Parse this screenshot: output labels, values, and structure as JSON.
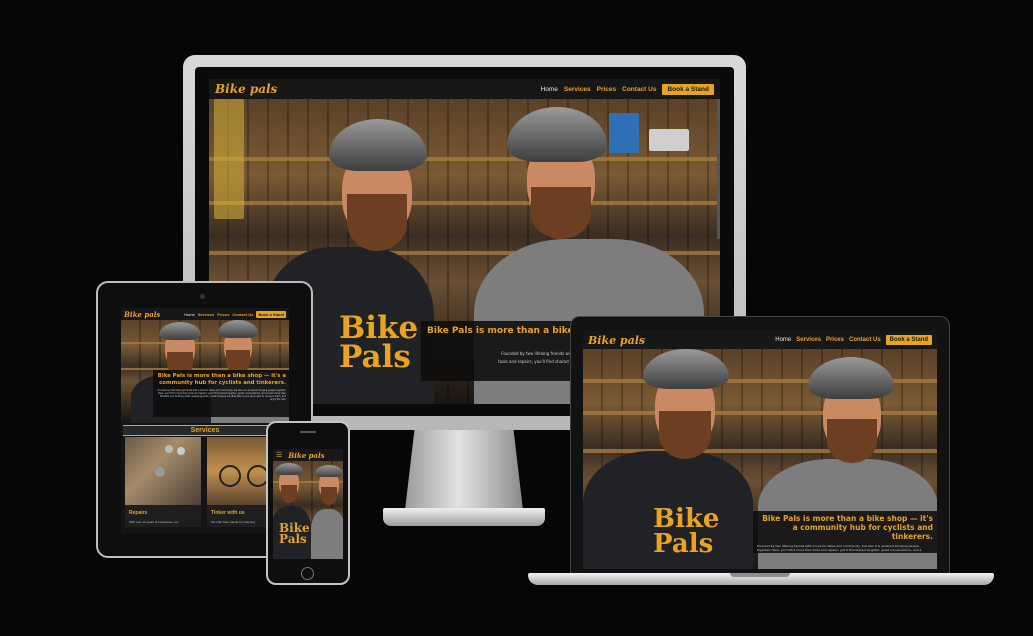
{
  "site": {
    "logo": "Bike pals",
    "nav": {
      "home": "Home",
      "services": "Services",
      "prices": "Prices",
      "contact": "Contact Us",
      "cta": "Book a Stand"
    },
    "shirt_text_line1": "Bike",
    "shirt_text_line2": "Pals",
    "hero_heading_desktop": "Bike Pals is more than a bike",
    "hero_heading_full": "Bike Pals is more than a bike shop — it's a community hub for cyclists and tinkerers.",
    "hero_body_desktop_1": "Founded by two lifelong friends with a love for bikes and community,",
    "hero_body_desktop_2": "tools and repairs, you'll find shared laughter, great conversations, and a",
    "hero_body_desktop_3": "just hanging out, Bike Pals",
    "hero_body_laptop": "Founded by two lifelong friends with a love for bikes and community, but also it is all about bringing people together. Here, you'll find more than tools and repairs; you'll find shared laughter, great conversations, and a welcoming vibe. Whether you're fixing a flat, swapping parts, or just hanging out, Bike Pals is your go-to spot to",
    "hero_body_tablet": "Founded by two lifelong friends with a love for bikes and community, but also it is all about bringing people together. Here, you'll find more than tools and repairs; you'll find shared laughter, great conversations, and a welcoming vibe. Whether you're fixing a flat, swapping parts, or just hanging out, Bike Pals is your go-to spot to connect, learn, and enjoy the ride.",
    "services": {
      "heading": "Services",
      "cards": [
        {
          "title": "Repairs",
          "text": "With over 10 years of experience, we"
        },
        {
          "title": "Tinker with us",
          "text": "We offer bike stands for tinkering"
        }
      ]
    }
  },
  "colors": {
    "accent": "#e8a321",
    "background": "#060606",
    "site_dark": "#141414"
  }
}
